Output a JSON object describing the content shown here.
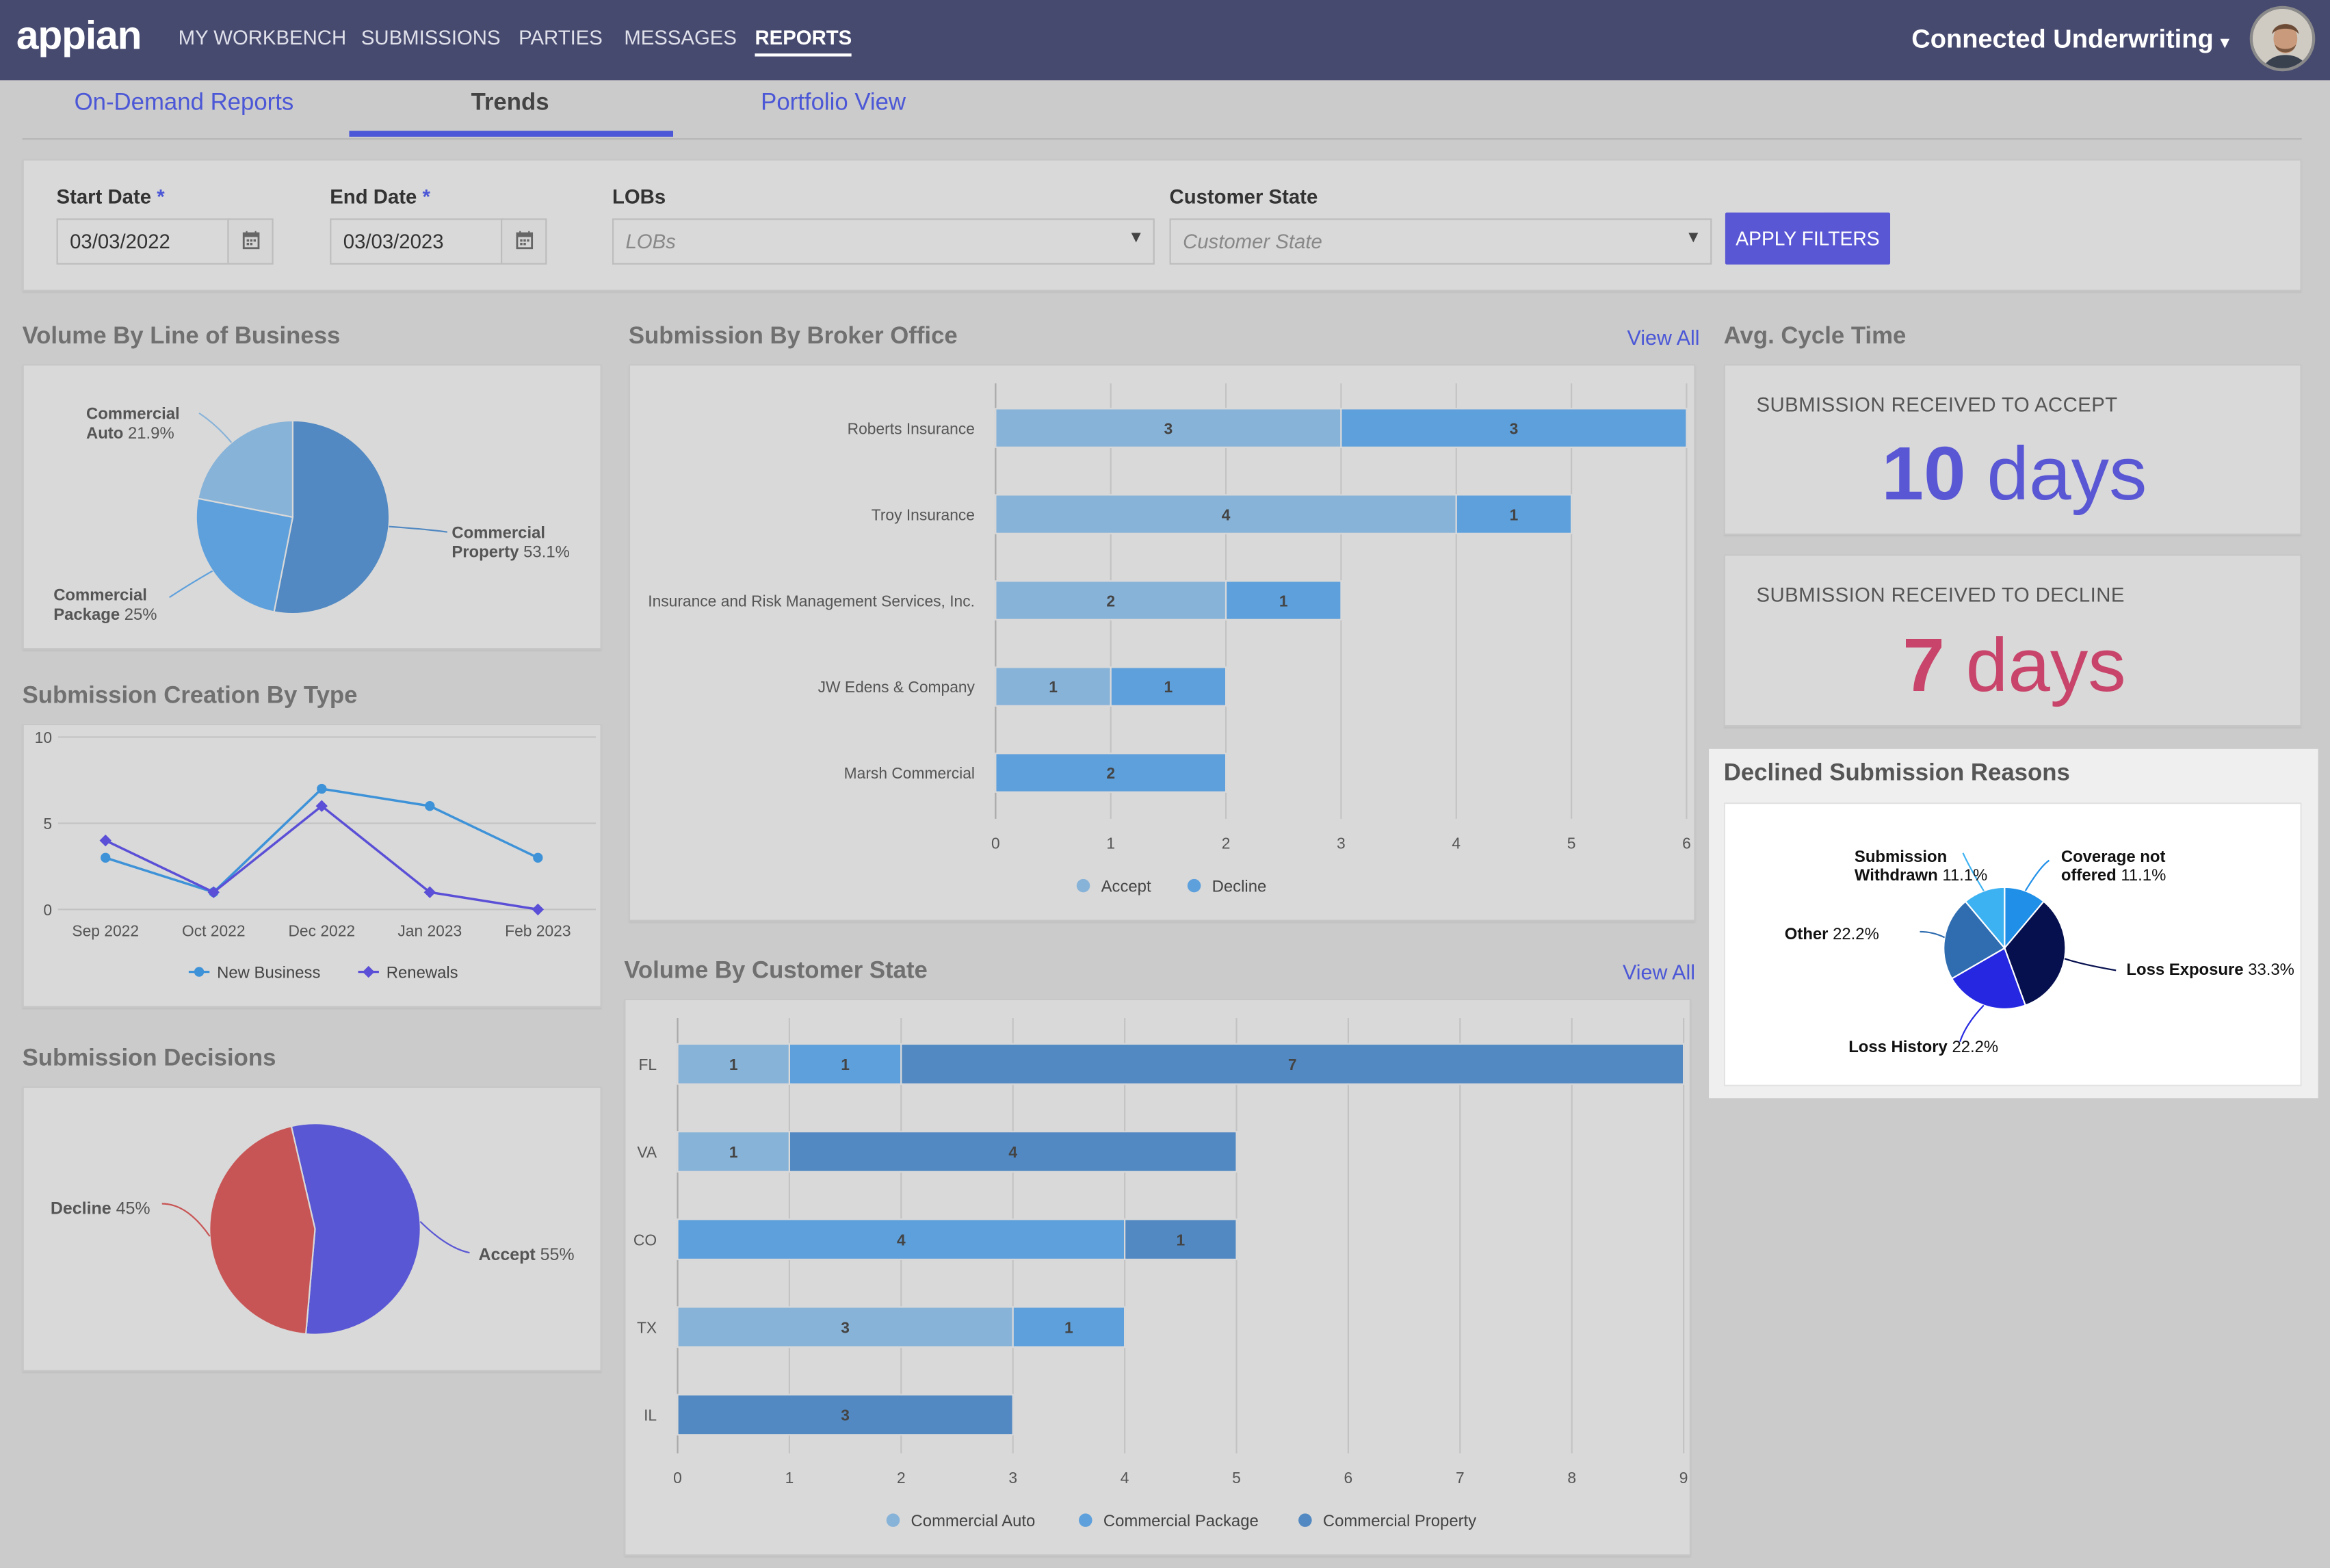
{
  "header": {
    "logo": "appian",
    "nav": [
      "MY WORKBENCH",
      "SUBMISSIONS",
      "PARTIES",
      "MESSAGES",
      "REPORTS"
    ],
    "active_nav": "REPORTS",
    "app_name": "Connected Underwriting"
  },
  "tabs": [
    "On-Demand Reports",
    "Trends",
    "Portfolio View"
  ],
  "active_tab": "Trends",
  "filters": {
    "start_date": {
      "label": "Start Date",
      "required_mark": "*",
      "value": "03/03/2022"
    },
    "end_date": {
      "label": "End Date",
      "required_mark": "*",
      "value": "03/03/2023"
    },
    "lobs": {
      "label": "LOBs",
      "placeholder": "LOBs"
    },
    "customer_state": {
      "label": "Customer State",
      "placeholder": "Customer State"
    },
    "apply_label": "APPLY FILTERS"
  },
  "sections": {
    "volume_lob": "Volume By Line of Business",
    "broker": "Submission By Broker Office",
    "broker_link": "View All",
    "cycle": "Avg. Cycle Time",
    "creation": "Submission Creation By Type",
    "decisions": "Submission Decisions",
    "state": "Volume By Customer State",
    "state_link": "View All",
    "declined": "Declined Submission Reasons"
  },
  "cycle_time": {
    "accept": {
      "label": "SUBMISSION RECEIVED TO ACCEPT",
      "value": "10",
      "unit": "days"
    },
    "decline": {
      "label": "SUBMISSION RECEIVED TO DECLINE",
      "value": "7",
      "unit": "days"
    }
  },
  "colors": {
    "accent": "#4b57d6",
    "header": "#474a6f",
    "accept_metric": "#5a57d4",
    "decline_metric": "#c8446a"
  },
  "chart_data": [
    {
      "id": "volume_lob",
      "type": "pie",
      "slices": [
        {
          "label": "Commercial Property",
          "value": 53.1,
          "pct_label": "53.1%",
          "name_lines": [
            "Commercial",
            "Property"
          ],
          "color": "#5289c2"
        },
        {
          "label": "Commercial Package",
          "value": 25,
          "pct_label": "25%",
          "name_lines": [
            "Commercial",
            "Package"
          ],
          "color": "#5ea0dc"
        },
        {
          "label": "Commercial Auto",
          "value": 21.9,
          "pct_label": "21.9%",
          "name_lines": [
            "Commercial",
            "Auto"
          ],
          "color": "#88b3d8"
        }
      ]
    },
    {
      "id": "broker",
      "type": "bar",
      "orientation": "horizontal",
      "stacked": true,
      "categories": [
        "Roberts Insurance",
        "Troy Insurance",
        "Insurance and Risk Management Services, Inc.",
        "JW Edens & Company",
        "Marsh Commercial"
      ],
      "series": [
        {
          "name": "Accept",
          "values": [
            3,
            4,
            2,
            1,
            0
          ],
          "color": "#88b3d8"
        },
        {
          "name": "Decline",
          "values": [
            3,
            1,
            1,
            1,
            2
          ],
          "color": "#5ea0dc"
        }
      ],
      "xlim": [
        0,
        6
      ],
      "xticks": [
        0,
        1,
        2,
        3,
        4,
        5,
        6
      ],
      "legend": "bottom",
      "grid": true
    },
    {
      "id": "creation",
      "type": "line",
      "x": [
        "Sep 2022",
        "Oct 2022",
        "Dec 2022",
        "Jan 2023",
        "Feb 2023"
      ],
      "series": [
        {
          "name": "New Business",
          "values": [
            3,
            1,
            7,
            6,
            3
          ],
          "color": "#3d92d8"
        },
        {
          "name": "Renewals",
          "values": [
            4,
            1,
            6,
            1,
            0
          ],
          "color": "#5a4fd6"
        }
      ],
      "ylim": [
        0,
        10
      ],
      "yticks": [
        0,
        5,
        10
      ],
      "legend": "bottom",
      "grid": true
    },
    {
      "id": "decisions",
      "type": "pie",
      "slices": [
        {
          "label": "Accept",
          "value": 55,
          "pct_label": "55%",
          "color": "#5a57d4"
        },
        {
          "label": "Decline",
          "value": 45,
          "pct_label": "45%",
          "color": "#c85555"
        }
      ]
    },
    {
      "id": "state",
      "type": "bar",
      "orientation": "horizontal",
      "stacked": true,
      "categories": [
        "FL",
        "VA",
        "CO",
        "TX",
        "IL"
      ],
      "series": [
        {
          "name": "Commercial Auto",
          "values": [
            1,
            1,
            0,
            3,
            0
          ],
          "color": "#88b3d8"
        },
        {
          "name": "Commercial Package",
          "values": [
            1,
            0,
            4,
            1,
            0
          ],
          "color": "#5ea0dc"
        },
        {
          "name": "Commercial Property",
          "values": [
            7,
            4,
            1,
            0,
            3
          ],
          "color": "#5289c2"
        }
      ],
      "xlim": [
        0,
        9
      ],
      "xticks": [
        0,
        1,
        2,
        3,
        4,
        5,
        6,
        7,
        8,
        9
      ],
      "legend": "bottom",
      "grid": true
    },
    {
      "id": "declined",
      "type": "pie",
      "slices": [
        {
          "label": "Coverage not offered",
          "value": 11.1,
          "pct_label": "11.1%",
          "name_lines": [
            "Coverage not",
            "offered"
          ],
          "color": "#1f8fe8"
        },
        {
          "label": "Loss Exposure",
          "value": 33.3,
          "pct_label": "33.3%",
          "name_lines": [
            "Loss Exposure"
          ],
          "color": "#07104f"
        },
        {
          "label": "Loss History",
          "value": 22.2,
          "pct_label": "22.2%",
          "name_lines": [
            "Loss History"
          ],
          "color": "#2528e0"
        },
        {
          "label": "Other",
          "value": 22.2,
          "pct_label": "22.2%",
          "name_lines": [
            "Other"
          ],
          "color": "#2f6db0"
        },
        {
          "label": "Submission Withdrawn",
          "value": 11.1,
          "pct_label": "11.1%",
          "name_lines": [
            "Submission",
            "Withdrawn"
          ],
          "color": "#3db2f2"
        }
      ]
    }
  ]
}
